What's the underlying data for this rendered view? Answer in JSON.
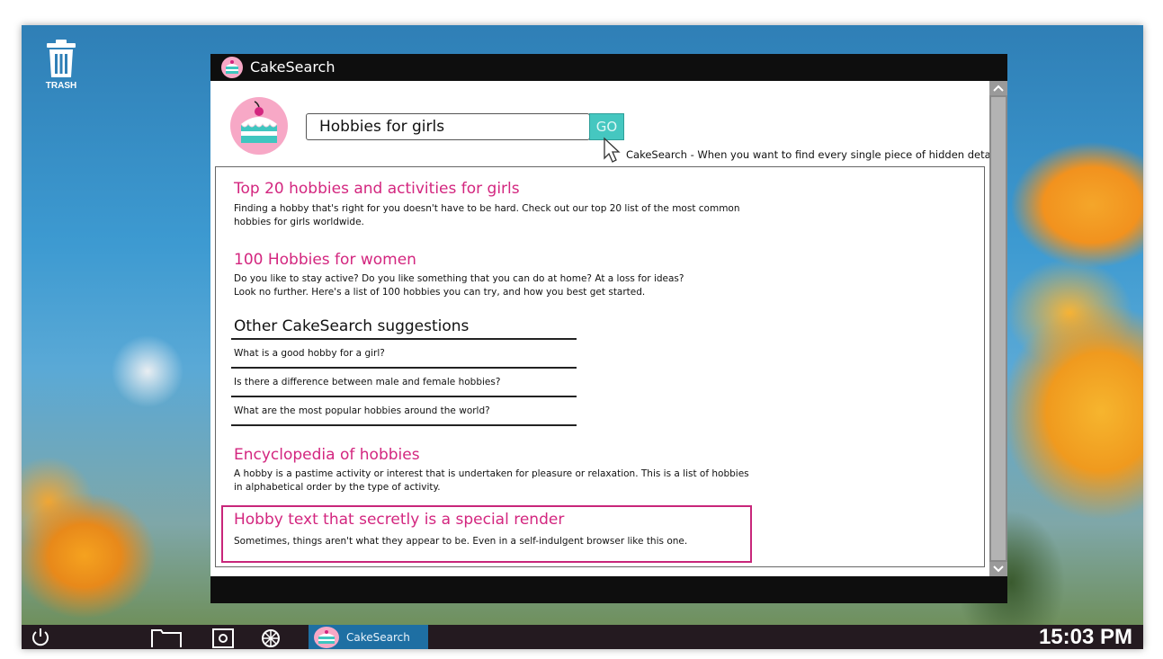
{
  "desktop": {
    "trash_label": "TRASH"
  },
  "window": {
    "title": "CakeSearch",
    "icon": "cake-icon"
  },
  "search": {
    "query": "Hobbies for girls",
    "go_label": "GO",
    "tagline": "CakeSearch - When you want to find every single piece of hidden detail."
  },
  "results": [
    {
      "title": "Top 20 hobbies and activities for girls",
      "desc_line1": "Finding a hobby that's right for you doesn't have to be hard. Check out our top 20 list of the most common",
      "desc_line2": "hobbies for girls worldwide."
    },
    {
      "title": "100 Hobbies for women",
      "desc_line1": "Do you like to stay active? Do you like something that you can do at home? At a loss for ideas?",
      "desc_line2": "Look no further. Here's a list of 100 hobbies you can try, and how you best get started."
    },
    {
      "title": "Encyclopedia of hobbies",
      "desc_line1": "A hobby is a pastime activity or interest that is undertaken for pleasure or relaxation. This is a list of hobbies",
      "desc_line2": "in alphabetical order by the type of activity."
    },
    {
      "title": "Hobby text that secretly is a special render",
      "desc_line1": "Sometimes, things aren't what they appear to be. Even in a self-indulgent browser like this one."
    }
  ],
  "suggestions": {
    "heading": "Other CakeSearch suggestions",
    "items": [
      "What is a good hobby for a girl?",
      "Is there a difference between male and female hobbies?",
      "What are the most popular hobbies around the world?"
    ]
  },
  "taskbar": {
    "app_label": "CakeSearch",
    "clock": "15:03 PM",
    "icons": [
      "power-icon",
      "folder-icon",
      "camera-icon",
      "settings-wheel-icon"
    ]
  },
  "colors": {
    "accent_pink": "#d3267f",
    "go_button": "#45c7c0",
    "taskbar": "#241a20",
    "taskbar_active": "#1e6fa3"
  }
}
